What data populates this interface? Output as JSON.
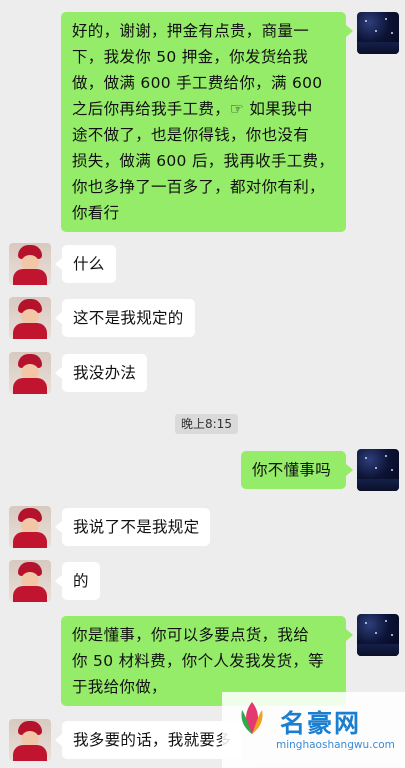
{
  "colors": {
    "self_bubble": "#95ec69",
    "other_bubble": "#ffffff",
    "background": "#ededed"
  },
  "messages": [
    {
      "id": "m1",
      "from": "self",
      "lines": [
        "好的，谢谢，押金有点贵，商量一",
        "下，我发你 50 押金，你发货给我",
        "做，做满 600 手工费给你，满 600",
        "之后你再给我手工费，☞ 如果我中",
        "途不做了，也是你得钱，你也没有",
        "损失，做满 600 后，我再收手工费，",
        "你也多挣了一百多了，都对你有利，",
        "你看行"
      ]
    },
    {
      "id": "m2",
      "from": "other",
      "lines": [
        "什么"
      ]
    },
    {
      "id": "m3",
      "from": "other",
      "lines": [
        "这不是我规定的"
      ]
    },
    {
      "id": "m4",
      "from": "other",
      "lines": [
        "我没办法"
      ]
    },
    {
      "id": "m5",
      "from": "self",
      "lines": [
        "你不懂事吗"
      ]
    },
    {
      "id": "m6",
      "from": "other",
      "lines": [
        "我说了不是我规定"
      ]
    },
    {
      "id": "m7",
      "from": "other",
      "lines": [
        "的"
      ]
    },
    {
      "id": "m8",
      "from": "self",
      "lines": [
        "你是懂事，你可以多要点货，我给",
        "你 50 材料费，你个人发我发货，等",
        "于我给你做，"
      ]
    },
    {
      "id": "m9",
      "from": "other",
      "lines": [
        "我多要的话，我就要多"
      ]
    }
  ],
  "timestamp": "晚上8:15",
  "watermark": {
    "name": "名豪网",
    "url": "minghaoshangwu.com"
  }
}
